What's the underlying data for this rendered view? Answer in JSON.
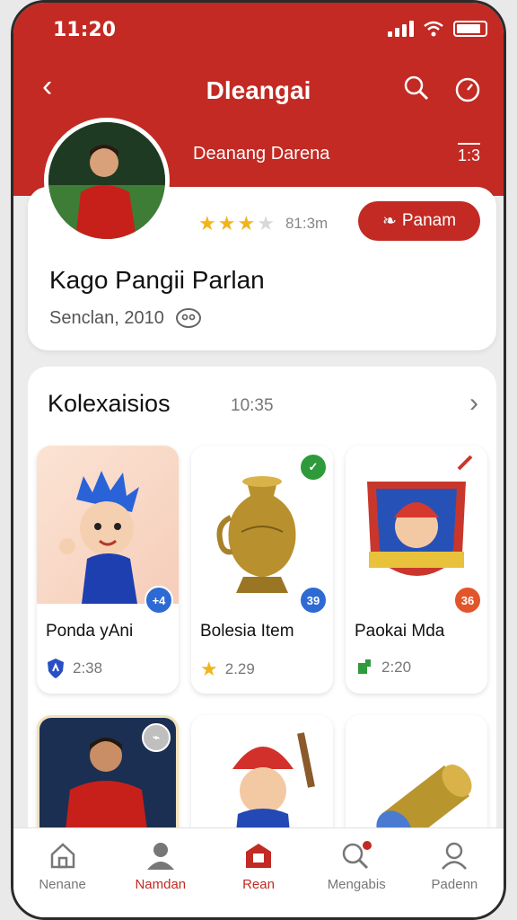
{
  "status": {
    "time": "11:20"
  },
  "nav": {
    "title": "Dleangai"
  },
  "profile": {
    "header_name": "Deanang Darena",
    "header_count": "1:3",
    "rating_value": "81:3m",
    "follow_label": "Panam",
    "name": "Kago Pangii Parlan",
    "subtitle": "Senclan, 2010"
  },
  "collection": {
    "title": "Kolexaisios",
    "count": "10:35",
    "items": [
      {
        "name": "Ponda yAni",
        "value": "2:38",
        "badge": "+4"
      },
      {
        "name": "Bolesia Item",
        "value": "2.29",
        "badge": "39"
      },
      {
        "name": "Paokai Mda",
        "value": "2:20",
        "badge": "36"
      }
    ]
  },
  "tabs": [
    {
      "label": "Nenane"
    },
    {
      "label": "Namdan"
    },
    {
      "label": "Rean"
    },
    {
      "label": "Mengabis"
    },
    {
      "label": "Padenn"
    }
  ],
  "colors": {
    "accent": "#c22a23",
    "star": "#f1b51c"
  }
}
